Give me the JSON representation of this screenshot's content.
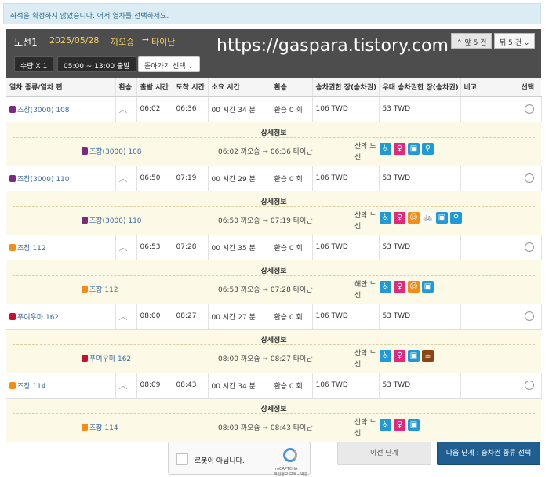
{
  "alert": {
    "text": "좌석을 확정하지 않았습니다. 어서 열차를 선택하세요."
  },
  "header": {
    "route_label": "노선1",
    "date": "2025/05/28",
    "from": "까오숑",
    "arrow": "➞",
    "to": "타이난",
    "watermark": "https://gaspara.tistory.com",
    "qty_label": "수량 X 1",
    "time_label": "05:00 ~ 13:00 출발",
    "return_label": "돌아가기 선택",
    "chevron": "⌄",
    "prev_page": "앞 5 건",
    "next_page": "뒤 5 건"
  },
  "table": {
    "headers": [
      "열차 종류/열차 편",
      "환승",
      "출발 시간",
      "도착 시간",
      "소요 시간",
      "환승",
      "승차권한 장(승차권)",
      "우대 승차권한 장(승차권)",
      "비고",
      "선택"
    ],
    "detail_title": "상세정보",
    "trains": [
      {
        "name": "즈창(3000) 108",
        "icon_color": "#7b2a7e",
        "depart": "06:02",
        "arrive": "06:36",
        "duration": "00 시간 34 분",
        "transfers": "환승 0 회",
        "fare": "106 TWD",
        "discount": "53 TWD",
        "note": "",
        "detail_time": "06:02 까오숑 ➞ 06:36 타이난",
        "line": "산악 노선",
        "icons": [
          {
            "name": "wheelchair-icon",
            "color": "#1e9bd7",
            "glyph": "♿"
          },
          {
            "name": "nursing-icon",
            "color": "#e6267a",
            "glyph": "♀"
          },
          {
            "name": "toilet-icon",
            "color": "#1e9bd7",
            "glyph": "▣"
          },
          {
            "name": "family-icon",
            "color": "#1e9bd7",
            "glyph": "⚲"
          }
        ]
      },
      {
        "name": "즈창(3000) 110",
        "icon_color": "#7b2a7e",
        "depart": "06:50",
        "arrive": "07:19",
        "duration": "00 시간 29 분",
        "transfers": "환승 0 회",
        "fare": "106 TWD",
        "discount": "53 TWD",
        "note": "",
        "detail_time": "06:50 까오숑 ➞ 07:19 타이난",
        "line": "산악 노선",
        "icons": [
          {
            "name": "wheelchair-icon",
            "color": "#1e9bd7",
            "glyph": "♿"
          },
          {
            "name": "nursing-icon",
            "color": "#e6267a",
            "glyph": "♀"
          },
          {
            "name": "child-icon",
            "color": "#f28c1a",
            "glyph": "☺"
          },
          {
            "name": "bicycle-icon",
            "color": "#ffffff",
            "glyph": "🚲"
          },
          {
            "name": "toilet-icon",
            "color": "#1e9bd7",
            "glyph": "▣"
          },
          {
            "name": "family-icon",
            "color": "#1e9bd7",
            "glyph": "⚲"
          }
        ]
      },
      {
        "name": "즈창 112",
        "icon_color": "#f28c1a",
        "depart": "06:53",
        "arrive": "07:28",
        "duration": "00 시간 35 분",
        "transfers": "환승 0 회",
        "fare": "106 TWD",
        "discount": "53 TWD",
        "note": "",
        "detail_time": "06:53 까오숑 ➞ 07:28 타이난",
        "line": "해안 노선",
        "icons": [
          {
            "name": "wheelchair-icon",
            "color": "#1e9bd7",
            "glyph": "♿"
          },
          {
            "name": "nursing-icon",
            "color": "#e6267a",
            "glyph": "♀"
          },
          {
            "name": "child-icon",
            "color": "#f28c1a",
            "glyph": "☺"
          },
          {
            "name": "toilet-icon",
            "color": "#1e9bd7",
            "glyph": "▣"
          }
        ]
      },
      {
        "name": "푸여우마 162",
        "icon_color": "#c8102e",
        "depart": "08:00",
        "arrive": "08:27",
        "duration": "00 시간 27 분",
        "transfers": "환승 0 회",
        "fare": "106 TWD",
        "discount": "53 TWD",
        "note": "",
        "detail_time": "08:00 까오숑 ➞ 08:27 타이난",
        "line": "산악 노선",
        "icons": [
          {
            "name": "wheelchair-icon",
            "color": "#1e9bd7",
            "glyph": "♿"
          },
          {
            "name": "nursing-icon",
            "color": "#e6267a",
            "glyph": "♀"
          },
          {
            "name": "toilet-icon",
            "color": "#1e9bd7",
            "glyph": "▣"
          },
          {
            "name": "dining-icon",
            "color": "#8b4513",
            "glyph": "☕"
          }
        ]
      },
      {
        "name": "즈창 114",
        "icon_color": "#f28c1a",
        "depart": "08:09",
        "arrive": "08:43",
        "duration": "00 시간 34 분",
        "transfers": "환승 0 회",
        "fare": "106 TWD",
        "discount": "53 TWD",
        "note": "",
        "detail_time": "08:09 까오숑 ➞ 08:43 타이난",
        "line": "산악 노선",
        "icons": [
          {
            "name": "wheelchair-icon",
            "color": "#1e9bd7",
            "glyph": "♿"
          },
          {
            "name": "nursing-icon",
            "color": "#e6267a",
            "glyph": "♀"
          },
          {
            "name": "toilet-icon",
            "color": "#1e9bd7",
            "glyph": "▣"
          }
        ]
      }
    ]
  },
  "captcha": {
    "label": "로봇이 아닙니다.",
    "brand": "reCAPTCHA",
    "sub": "개인정보 보호 - 약관"
  },
  "buttons": {
    "prev": "이전 단계",
    "next": "다음 단계 : 승차권 종류 선택"
  },
  "colors": {
    "panel": "#4d4d4d",
    "accent_yellow": "#f0d060",
    "next_button": "#1f5e8e",
    "detail_bg": "#fdf9e7"
  }
}
